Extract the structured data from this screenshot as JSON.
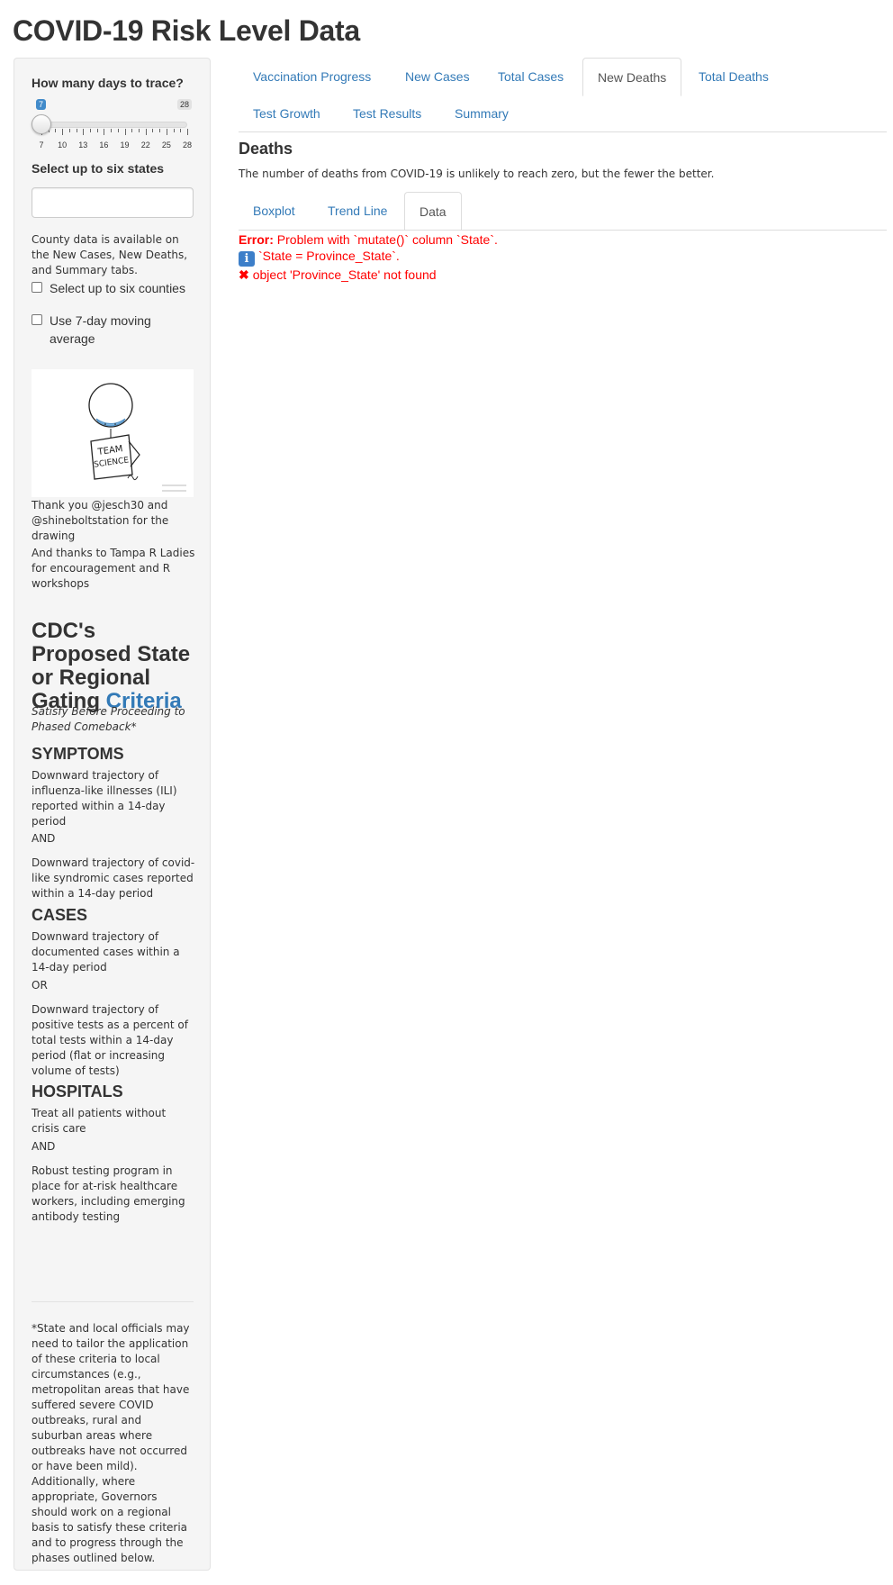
{
  "app": {
    "title": "COVID-19 Risk Level Data"
  },
  "sidebar": {
    "slider": {
      "label": "How many days to trace?",
      "min_label": "7",
      "max_label": "28",
      "value": 7,
      "min": 7,
      "max": 28,
      "tick_labels": [
        "7",
        "10",
        "13",
        "16",
        "19",
        "22",
        "25",
        "28"
      ]
    },
    "states": {
      "label": "Select up to six states",
      "value": "",
      "placeholder": ""
    },
    "county_note": "County data is available on the New Cases, New Deaths, and Summary tabs.",
    "checkboxes": {
      "counties": {
        "label": "Select up to six counties",
        "checked": false
      },
      "moving_average": {
        "label": "Use 7-day moving average",
        "checked": false
      }
    },
    "drawing": {
      "sign_text_1": "TEAM",
      "sign_text_2": "SCIENCE"
    },
    "thanks_1": "Thank you @jesch30 and @shineboltstation for the drawing",
    "thanks_2": "And thanks to Tampa R Ladies for encouragement and R workshops",
    "criteria": {
      "title_prefix": "CDC's Proposed State or Regional Gating",
      "title_link": "Criteria",
      "subtitle": "Satisfy Before Proceeding to Phased Comeback*",
      "sections": [
        {
          "heading": "SYMPTOMS",
          "p1": "Downward trajectory of influenza-like illnesses (ILI) reported within a 14-day period",
          "conj": "AND",
          "p2": "Downward trajectory of covid-like syndromic cases reported within a 14-day period"
        },
        {
          "heading": "CASES",
          "p1": "Downward trajectory of documented cases within a 14-day period",
          "conj": "OR",
          "p2": "Downward trajectory of positive tests as a percent of total tests within a 14-day period (flat or increasing volume of tests)"
        },
        {
          "heading": "HOSPITALS",
          "p1": "Treat all patients without crisis care",
          "conj": "AND",
          "p2": "Robust testing program in place for at-risk healthcare workers, including emerging antibody testing"
        }
      ],
      "footnote": "*State and local officials may need to tailor the application of these criteria to local circumstances (e.g., metropolitan areas that have suffered severe COVID outbreaks, rural and suburban areas where outbreaks have not occurred or have been mild). Additionally, where appropriate, Governors should work on a regional basis to satisfy these criteria and to progress through the phases outlined below."
    }
  },
  "main": {
    "tabs": [
      {
        "label": "Vaccination Progress",
        "active": false
      },
      {
        "label": "New Cases",
        "active": false
      },
      {
        "label": "Total Cases",
        "active": false
      },
      {
        "label": "New Deaths",
        "active": true
      },
      {
        "label": "Total Deaths",
        "active": false
      },
      {
        "label": "Test Growth",
        "active": false
      },
      {
        "label": "Test Results",
        "active": false
      },
      {
        "label": "Summary",
        "active": false
      }
    ],
    "heading": "Deaths",
    "description": "The number of deaths from COVID-19 is unlikely to reach zero, but the fewer the better.",
    "subtabs": [
      {
        "label": "Boxplot",
        "active": false
      },
      {
        "label": "Trend Line",
        "active": false
      },
      {
        "label": "Data",
        "active": true
      }
    ],
    "error": {
      "prefix": "Error:",
      "line1": "Problem with `mutate()` column `State`.",
      "info_glyph": "i",
      "line2": "`State = Province_State`.",
      "x_glyph": "✖",
      "line3": "object 'Province_State' not found"
    }
  },
  "colors": {
    "link": "#337ab7",
    "error": "#ff0000",
    "sidebar_bg": "#f5f5f5",
    "slider_accent": "#428bca"
  }
}
